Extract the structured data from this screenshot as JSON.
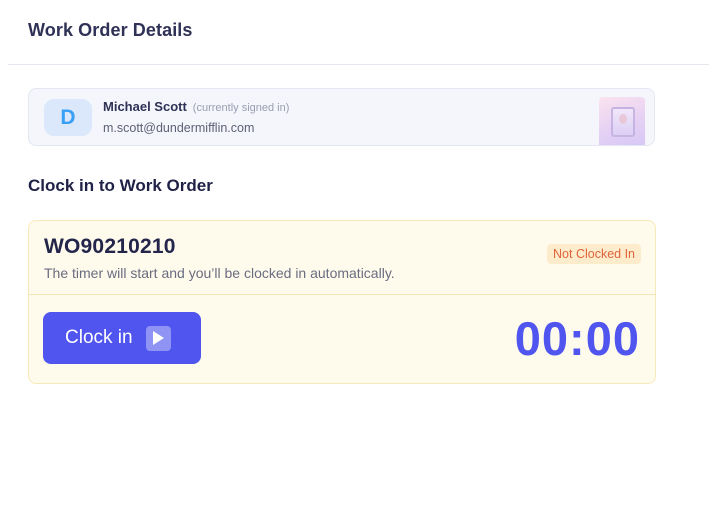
{
  "header": {
    "title": "Work Order Details"
  },
  "user": {
    "initial": "D",
    "name": "Michael Scott",
    "note": "(currently signed in)",
    "email": "m.scott@dundermifflin.com"
  },
  "clock_section": {
    "title": "Clock in to Work Order",
    "work_order_id": "WO90210210",
    "description": "The timer will start and you’ll be clocked in automatically.",
    "status": "Not Clocked In",
    "button_label": "Clock in",
    "button_icon": "play-icon",
    "timer": "00:00"
  },
  "colors": {
    "accent": "#4f55ee",
    "status_text": "#e0643a",
    "status_bg": "#fdeccc",
    "card_bg": "#fffbec"
  }
}
